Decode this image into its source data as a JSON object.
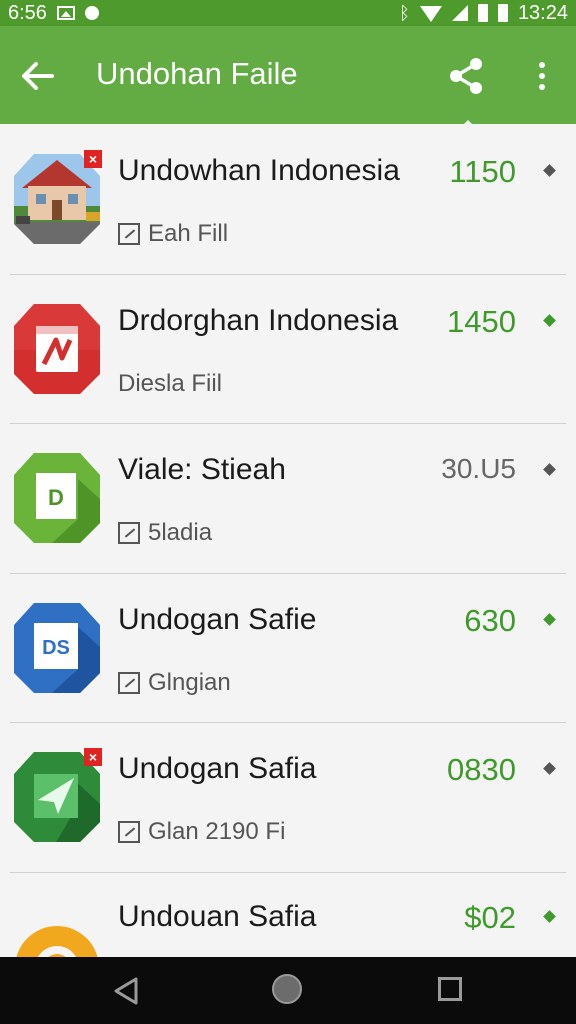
{
  "status_bar": {
    "time_left": "6:56",
    "time_right": "13:24",
    "icons": [
      "image-icon",
      "notification-dot-icon",
      "bluetooth-icon",
      "wifi-icon",
      "signal-icon",
      "battery-icon"
    ],
    "color": "#4f9a2c"
  },
  "app_bar": {
    "title": "Undohan Faile",
    "back_icon": "arrow-back-icon",
    "share_icon": "share-icon",
    "more_icon": "more-vert-icon",
    "color": "#62ac43"
  },
  "items": [
    {
      "title": "Undowhan Indonesia",
      "subtitle": "Eah Fill",
      "value": "1150",
      "value_color": "#3f9a2b",
      "icon": "house-photo-icon",
      "has_badge": true,
      "sub_icon": true
    },
    {
      "title": "Drdorghan Indonesia",
      "subtitle": "Diesla Fiil",
      "value": "1450",
      "value_color": "#3f9a2b",
      "icon": "red-pdf-icon",
      "has_badge": false,
      "sub_icon": false
    },
    {
      "title": "Viale: Stieah",
      "subtitle": "5ladia",
      "value": "30.U5",
      "value_color": "#666666",
      "icon": "green-doc-icon",
      "has_badge": false,
      "sub_icon": true
    },
    {
      "title": "Undogan Safie",
      "subtitle": "Glngian",
      "value": "630",
      "value_color": "#3f9a2b",
      "icon": "blue-ds-icon",
      "has_badge": false,
      "sub_icon": true
    },
    {
      "title": "Undogan Safia",
      "subtitle": "Glan 2190 Fi",
      "value": "0830",
      "value_color": "#3f9a2b",
      "icon": "green-plane-icon",
      "has_badge": true,
      "sub_icon": true
    },
    {
      "title": "Undouan Safia",
      "subtitle": "",
      "value": "$02",
      "value_color": "#3f9a2b",
      "icon": "orange-ring-icon",
      "has_badge": false,
      "sub_icon": false
    }
  ],
  "badge_text": "×",
  "diamond_symbol": "◆",
  "icon_text": {
    "green_doc": "D",
    "blue_ds": "DS"
  },
  "nav_bar": {
    "back_icon": "nav-back-icon",
    "home_icon": "nav-home-icon",
    "recents_icon": "nav-recents-icon"
  }
}
